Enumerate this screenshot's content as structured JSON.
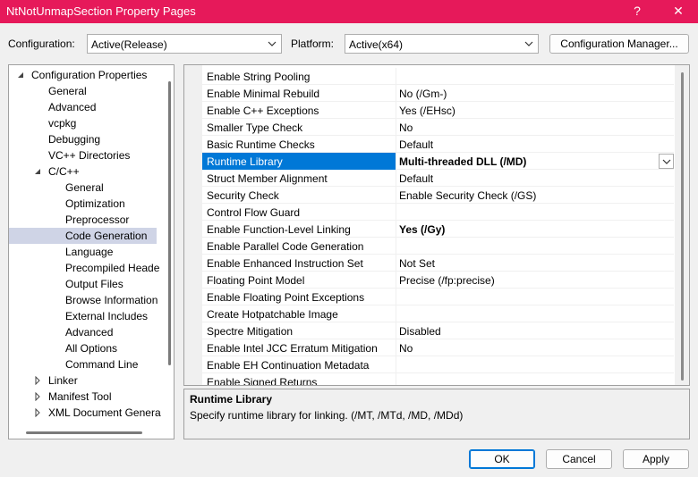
{
  "window": {
    "title": "NtNotUnmapSection Property Pages",
    "help_glyph": "?",
    "close_glyph": "✕"
  },
  "toolbar": {
    "configuration_label": "Configuration:",
    "configuration_value": "Active(Release)",
    "platform_label": "Platform:",
    "platform_value": "Active(x64)",
    "config_manager_label": "Configuration Manager..."
  },
  "tree": {
    "items": [
      {
        "label": "Configuration Properties",
        "expanded": true
      },
      {
        "label": "General"
      },
      {
        "label": "Advanced"
      },
      {
        "label": "vcpkg"
      },
      {
        "label": "Debugging"
      },
      {
        "label": "VC++ Directories"
      },
      {
        "label": "C/C++",
        "expanded": true
      },
      {
        "label": "General"
      },
      {
        "label": "Optimization"
      },
      {
        "label": "Preprocessor"
      },
      {
        "label": "Code Generation",
        "selected": true
      },
      {
        "label": "Language"
      },
      {
        "label": "Precompiled Heade"
      },
      {
        "label": "Output Files"
      },
      {
        "label": "Browse Information"
      },
      {
        "label": "External Includes"
      },
      {
        "label": "Advanced"
      },
      {
        "label": "All Options"
      },
      {
        "label": "Command Line"
      },
      {
        "label": "Linker",
        "expanded": false
      },
      {
        "label": "Manifest Tool",
        "expanded": false
      },
      {
        "label": "XML Document Genera",
        "expanded": false
      }
    ]
  },
  "properties": [
    {
      "name": "Enable String Pooling",
      "value": ""
    },
    {
      "name": "Enable Minimal Rebuild",
      "value": "No (/Gm-)"
    },
    {
      "name": "Enable C++ Exceptions",
      "value": "Yes (/EHsc)"
    },
    {
      "name": "Smaller Type Check",
      "value": "No"
    },
    {
      "name": "Basic Runtime Checks",
      "value": "Default"
    },
    {
      "name": "Runtime Library",
      "value": "Multi-threaded DLL (/MD)"
    },
    {
      "name": "Struct Member Alignment",
      "value": "Default"
    },
    {
      "name": "Security Check",
      "value": "Enable Security Check (/GS)"
    },
    {
      "name": "Control Flow Guard",
      "value": ""
    },
    {
      "name": "Enable Function-Level Linking",
      "value": "Yes (/Gy)"
    },
    {
      "name": "Enable Parallel Code Generation",
      "value": ""
    },
    {
      "name": "Enable Enhanced Instruction Set",
      "value": "Not Set"
    },
    {
      "name": "Floating Point Model",
      "value": "Precise (/fp:precise)"
    },
    {
      "name": "Enable Floating Point Exceptions",
      "value": ""
    },
    {
      "name": "Create Hotpatchable Image",
      "value": ""
    },
    {
      "name": "Spectre Mitigation",
      "value": "Disabled"
    },
    {
      "name": "Enable Intel JCC Erratum Mitigation",
      "value": "No"
    },
    {
      "name": "Enable EH Continuation Metadata",
      "value": ""
    },
    {
      "name": "Enable Signed Returns",
      "value": ""
    }
  ],
  "description": {
    "title": "Runtime Library",
    "text": "Specify runtime library for linking.      (/MT, /MTd, /MD, /MDd)"
  },
  "buttons": {
    "ok": "OK",
    "cancel": "Cancel",
    "apply": "Apply"
  },
  "colors": {
    "titlebar": "#e6195a",
    "selection": "#0078d7",
    "tree_selection": "#cfd4e6"
  }
}
